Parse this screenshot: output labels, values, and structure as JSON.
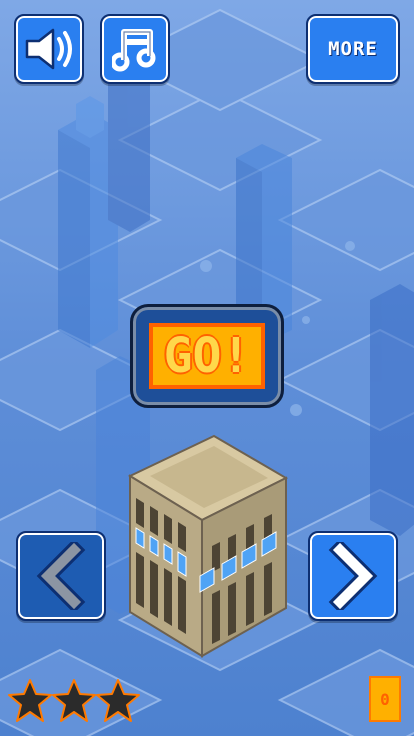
{
  "game": {
    "title": "GO!",
    "more_label": "MORE",
    "coin_count": "0",
    "stars_filled": 0,
    "stars_total": 3
  },
  "icons": {
    "sound": "speaker-icon",
    "music": "music-note-icon",
    "prev": "chevron-left-icon",
    "next": "chevron-right-icon",
    "star": "star-icon"
  },
  "colors": {
    "button_blue": "#2a7ff0",
    "button_border": "#0d2f72",
    "go_fill": "#ffb000",
    "go_border": "#ff6200",
    "star_empty": "#2b2b2b",
    "star_outline": "#ff7a00",
    "sky": "#5c8bd4"
  }
}
